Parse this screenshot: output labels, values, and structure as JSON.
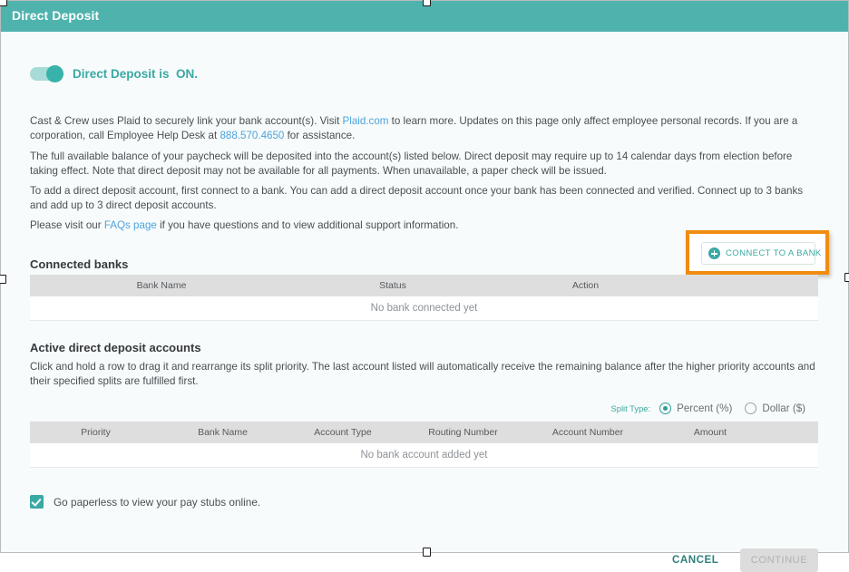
{
  "header": {
    "title": "Direct Deposit"
  },
  "toggle": {
    "state_label": "Direct Deposit is  ON.",
    "is_on": true,
    "accent_color": "#38b3ab"
  },
  "paragraphs": {
    "p1_part1": "Cast & Crew uses Plaid to securely link your bank account(s). Visit ",
    "p1_link1": "Plaid.com",
    "p1_part2": " to learn more. Updates on this page only affect employee personal records. If you are a corporation, call Employee Help Desk at ",
    "p1_link2": "888.570.4650",
    "p1_part3": " for assistance.",
    "p2": "The full available balance of your paycheck will be deposited into the account(s) listed below. Direct deposit may require up to 14 calendar days from election before taking effect. Note that direct deposit may not be available for all payments. When unavailable, a paper check will be issued.",
    "p3": "To add a direct deposit account, first connect to a bank. You can add a direct deposit account once your bank has been connected and verified. Connect up to 3 banks and add up to 3 direct deposit accounts.",
    "p4_part1": "Please visit our ",
    "p4_link": "FAQs page",
    "p4_part2": " if you have questions and to view additional support information."
  },
  "connected_banks": {
    "section_title": "Connected banks",
    "connect_button_label": "CONNECT TO A BANK",
    "highlight_color": "#f08c10",
    "columns": [
      "Bank Name",
      "Status",
      "Action",
      ""
    ],
    "empty_message": "No bank connected yet",
    "rows": []
  },
  "active_accounts": {
    "section_title": "Active direct deposit accounts",
    "description": "Click and hold a row to drag it and rearrange its split priority. The last account listed will automatically receive the remaining balance after the higher priority accounts and their specified splits are fulfilled first.",
    "split_type_label": "Split Type:",
    "split_options": [
      {
        "label": "Percent (%)",
        "selected": true
      },
      {
        "label": "Dollar ($)",
        "selected": false
      }
    ],
    "columns": [
      "Priority",
      "Bank Name",
      "Account Type",
      "Routing Number",
      "Account Number",
      "Amount",
      ""
    ],
    "empty_message": "No bank account added yet",
    "rows": []
  },
  "paperless": {
    "label": "Go paperless to view your pay stubs online.",
    "checked": true
  },
  "footer": {
    "cancel_label": "CANCEL",
    "continue_label": "CONTINUE",
    "continue_disabled": true
  }
}
